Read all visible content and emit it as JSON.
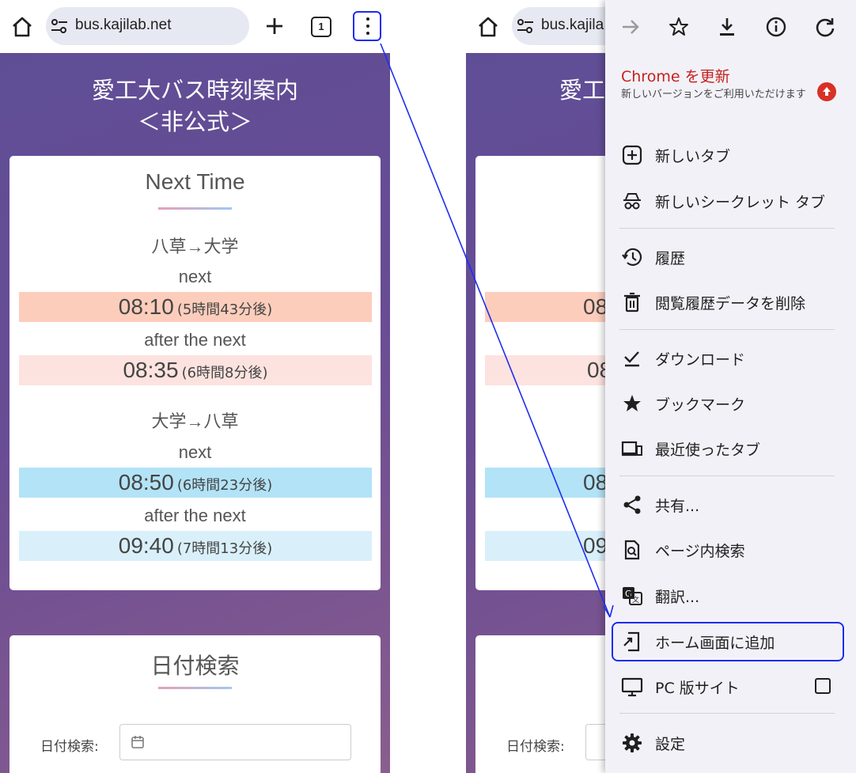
{
  "browser": {
    "url": "bus.kajilab.net",
    "url_right_partial": "bus.kajila",
    "tab_count": "1"
  },
  "site": {
    "title_line1": "愛工大バス時刻案内",
    "title_line2": "＜非公式＞",
    "title_partial": "愛工"
  },
  "next_time": {
    "title": "Next Time",
    "routes": [
      {
        "name": "八草→大学",
        "next_label": "next",
        "next_time": "08:10",
        "next_rel": "(5時間43分後)",
        "after_label": "after the next",
        "after_time": "08:35",
        "after_rel": "(6時間8分後)",
        "color_next": "#fdcdbc",
        "color_after": "#fde3df"
      },
      {
        "name": "大学→八草",
        "next_label": "next",
        "next_time": "08:50",
        "next_rel": "(6時間23分後)",
        "after_label": "after the next",
        "after_time": "09:40",
        "after_rel": "(7時間13分後)",
        "color_next": "#b3e3f7",
        "color_after": "#d9f0fa"
      }
    ],
    "partials_right": [
      "08",
      "08",
      "08",
      "09"
    ]
  },
  "date_search": {
    "title": "日付検索",
    "label": "日付検索:"
  },
  "menu": {
    "top_icons": [
      "forward-arrow-icon",
      "star-outline-icon",
      "download-icon",
      "info-icon",
      "reload-icon"
    ],
    "update_title": "Chrome を更新",
    "update_sub": "新しいバージョンをご利用いただけます",
    "items": {
      "new_tab": "新しいタブ",
      "incognito": "新しいシークレット タブ",
      "history": "履歴",
      "clear_data": "閲覧履歴データを削除",
      "downloads": "ダウンロード",
      "bookmarks": "ブックマーク",
      "recent_tabs": "最近使ったタブ",
      "share": "共有...",
      "find_in_page": "ページ内検索",
      "translate": "翻訳...",
      "add_to_home": "ホーム画面に追加",
      "desktop_site": "PC 版サイト",
      "settings": "設定"
    }
  },
  "colors": {
    "page_purple": "#654e95",
    "highlight_blue": "#1e2cf0",
    "update_red": "#c5221f"
  }
}
